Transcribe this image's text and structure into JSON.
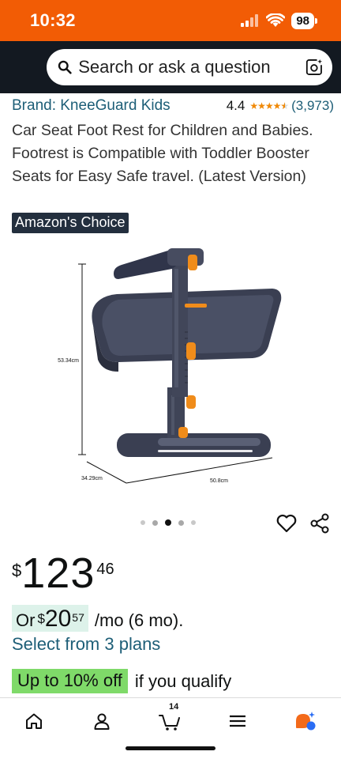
{
  "status_bar": {
    "time": "10:32",
    "battery": "98",
    "icons": [
      "cellular-signal-icon",
      "wifi-icon",
      "battery-icon"
    ],
    "background_color": "#f25c05"
  },
  "search": {
    "placeholder": "Search or ask a question",
    "icons": [
      "search-icon",
      "camera-lens-icon"
    ]
  },
  "product": {
    "brand": "Brand: KneeGuard Kids",
    "rating": "4.4",
    "stars": 4.5,
    "review_count": "(3,973)",
    "title": "Car Seat Foot Rest for Children and Babies. Footrest is Compatible with Toddler Booster Seats for Easy Safe travel. (Latest Version)",
    "badge": "Amazon's Choice",
    "image": {
      "dimension_height": "53.34cm",
      "dimension_depth": "34.29cm",
      "dimension_width": "50.8cm"
    },
    "carousel": {
      "count": 5,
      "active": 2
    },
    "actions": [
      "heart-icon",
      "share-icon"
    ]
  },
  "pricing": {
    "symbol": "$",
    "whole": "123",
    "fraction": "46",
    "monthly_prefix": "Or",
    "monthly_symbol": "$",
    "monthly_whole": "20",
    "monthly_fraction": "57",
    "monthly_suffix": "/mo (6 mo).",
    "plans_link": "Select from 3 plans",
    "qualify_badge": "Up to 10% off",
    "qualify_text": "if you qualify"
  },
  "bottom_nav": {
    "items": [
      "home-icon",
      "account-icon",
      "cart-icon",
      "menu-icon",
      "rufus-assistant-icon"
    ],
    "cart_count": "14"
  },
  "colors": {
    "link": "#1d5e77",
    "header": "#131921",
    "star": "#f08804",
    "qualify_badge": "#7fda69",
    "monthly_highlight": "#ddf2ea"
  }
}
